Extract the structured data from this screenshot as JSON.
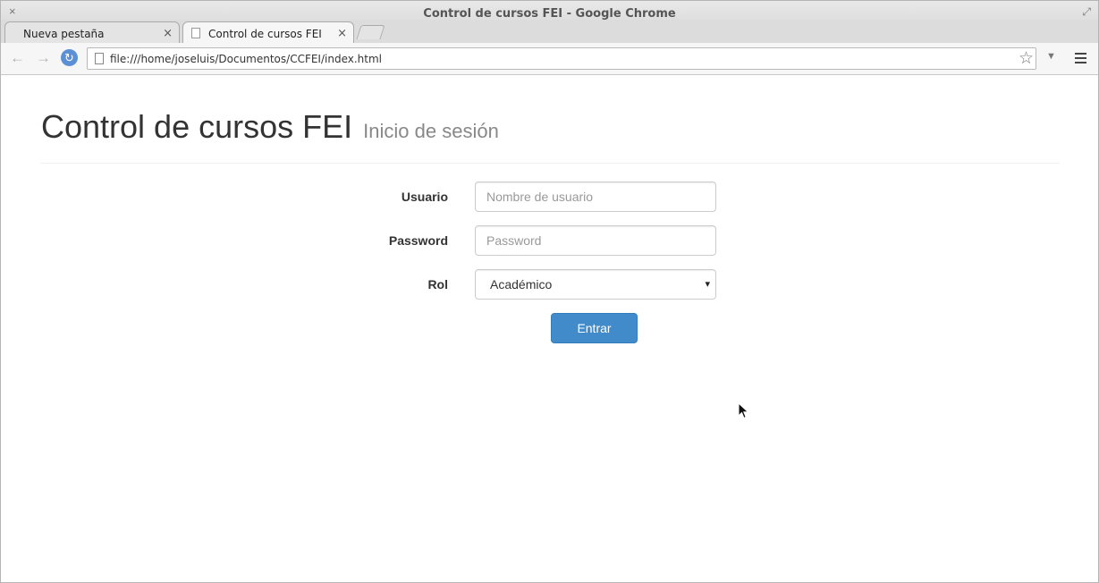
{
  "window": {
    "title": "Control de cursos FEI - Google Chrome",
    "close_glyph": "×",
    "maximize_glyph": "⤢"
  },
  "tabs": [
    {
      "label": "Nueva pestaña",
      "active": false
    },
    {
      "label": "Control de cursos FEI",
      "active": true
    }
  ],
  "tab_close_glyph": "×",
  "toolbar": {
    "back_glyph": "←",
    "forward_glyph": "→",
    "reload_glyph": "↻",
    "url": "file:///home/joseluis/Documentos/CCFEI/index.html",
    "bookmark_glyph": "☆",
    "dropdown_glyph": "▼"
  },
  "page": {
    "title": "Control de cursos FEI",
    "subtitle": "Inicio de sesión"
  },
  "form": {
    "usuario": {
      "label": "Usuario",
      "placeholder": "Nombre de usuario",
      "value": ""
    },
    "password": {
      "label": "Password",
      "placeholder": "Password",
      "value": ""
    },
    "rol": {
      "label": "Rol",
      "selected": "Académico",
      "caret": "▾"
    },
    "submit_label": "Entrar"
  },
  "colors": {
    "primary_button": "#428bca",
    "reload_icon": "#5b8fd6"
  }
}
